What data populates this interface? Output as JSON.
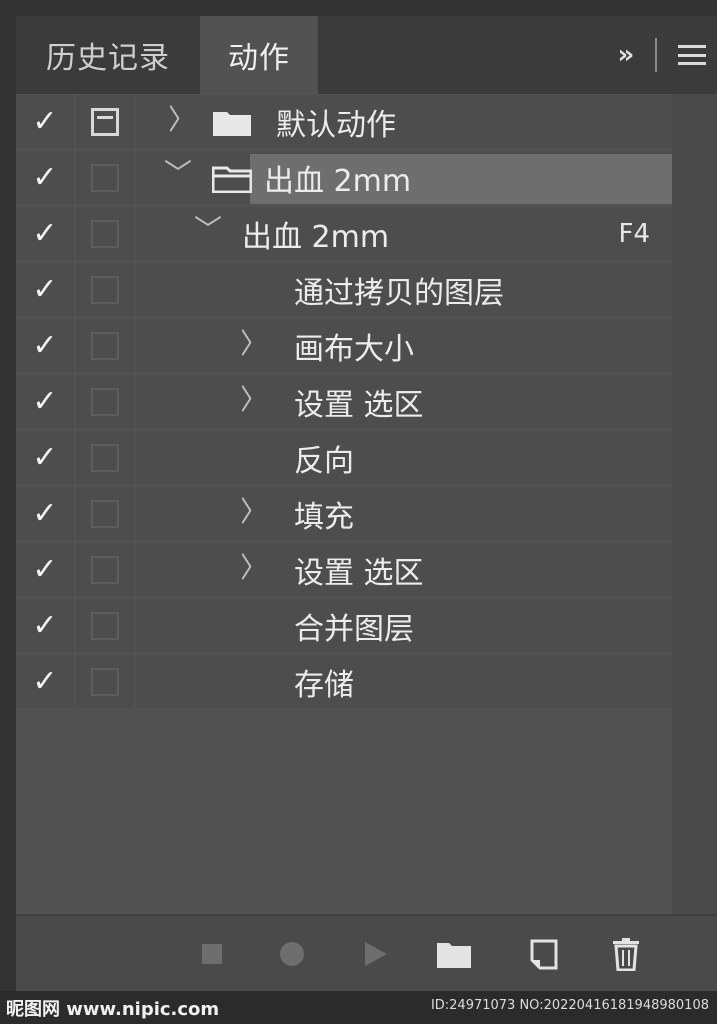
{
  "tabs": [
    {
      "label": "历史记录",
      "active": false
    },
    {
      "label": "动作",
      "active": true
    }
  ],
  "header_icons": {
    "expand": "»",
    "menu": "menu-icon"
  },
  "rows": [
    {
      "check": "✓",
      "chevron": "〉",
      "icon": "folder-icon",
      "label": "默认动作",
      "dialog_active": true
    },
    {
      "check": "✓",
      "chevron": "﹀",
      "icon": "folder-open-icon",
      "label": "出血 2mm",
      "selected": true
    },
    {
      "check": "✓",
      "chevron": "﹀",
      "label": "出血 2mm",
      "shortcut": "F4"
    },
    {
      "check": "✓",
      "label": "通过拷贝的图层"
    },
    {
      "check": "✓",
      "chevron": "〉",
      "label": "画布大小"
    },
    {
      "check": "✓",
      "chevron": "〉",
      "label": "设置 选区"
    },
    {
      "check": "✓",
      "label": "反向"
    },
    {
      "check": "✓",
      "chevron": "〉",
      "label": "填充"
    },
    {
      "check": "✓",
      "chevron": "〉",
      "label": "设置 选区"
    },
    {
      "check": "✓",
      "label": "合并图层"
    },
    {
      "check": "✓",
      "label": "存储"
    }
  ],
  "toolbar": {
    "buttons": [
      "stop-icon",
      "record-icon",
      "play-icon",
      "new-set-folder-icon",
      "new-action-icon",
      "trash-icon"
    ]
  },
  "watermark": {
    "left": "昵图网 www.nipic.com",
    "right": "ID:24971073 NO:20220416181948980108"
  },
  "colors": {
    "panel": "#525252",
    "row": "#4d4d4d",
    "selected": "#6e6e6e",
    "tabbar": "#3b3b3b"
  }
}
